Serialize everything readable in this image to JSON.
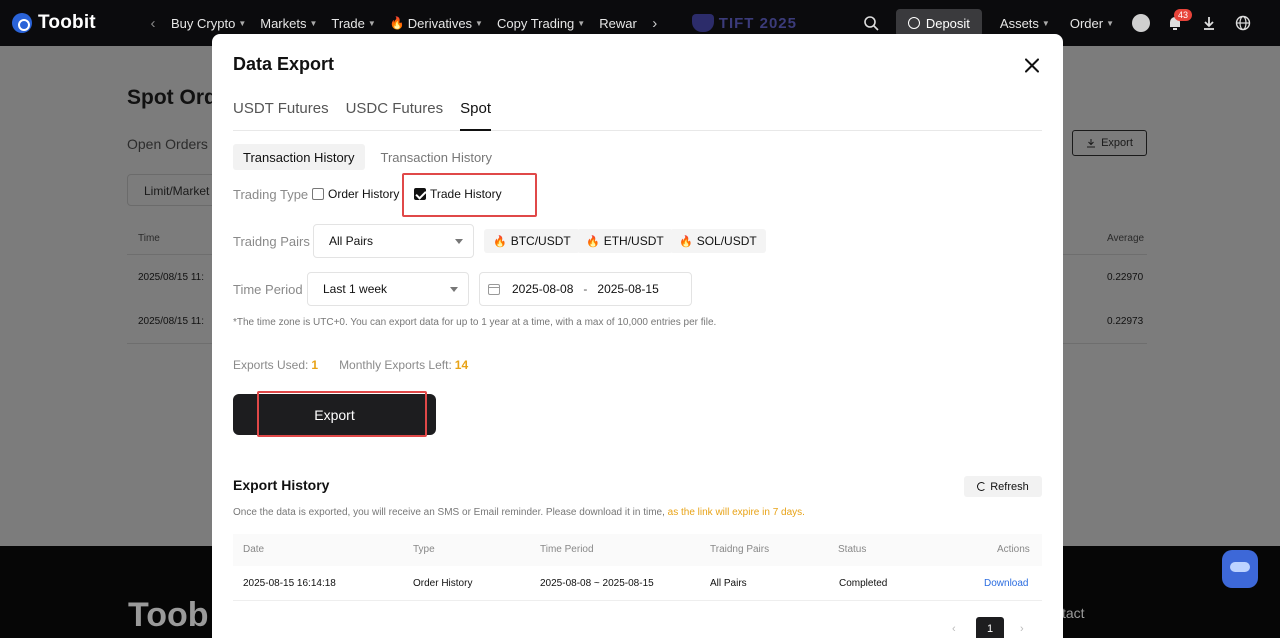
{
  "nav": {
    "brand": "Toobit",
    "items": [
      {
        "label": "Buy Crypto"
      },
      {
        "label": "Markets"
      },
      {
        "label": "Trade"
      },
      {
        "label": "Derivatives"
      },
      {
        "label": "Copy Trading"
      },
      {
        "label": "Rewar"
      }
    ],
    "event_label": "TIFT 2025",
    "deposit": "Deposit",
    "assets": "Assets",
    "order": "Order",
    "notification_count": "43"
  },
  "background": {
    "title": "Spot Ord",
    "tab": "Open Orders",
    "filter": "Limit/Market",
    "export": "Export",
    "col_time": "Time",
    "col_average": "Average",
    "rows": [
      {
        "time": "2025/08/15 11:",
        "average": "0.22970"
      },
      {
        "time": "2025/08/15 11:",
        "average": "0.22973"
      }
    ],
    "footer_logo": "Toob",
    "footer_contact": "tact"
  },
  "modal": {
    "title": "Data Export",
    "tabs": [
      {
        "label": "USDT Futures",
        "active": false
      },
      {
        "label": "USDC Futures",
        "active": false
      },
      {
        "label": "Spot",
        "active": true
      }
    ],
    "subtabs": [
      {
        "label": "Transaction History",
        "active": true
      },
      {
        "label": "Transaction History",
        "active": false
      }
    ],
    "trading_type_label": "Trading Type",
    "order_history_label": "Order History",
    "trade_history_label": "Trade History",
    "trading_pairs_label": "Traidng Pairs",
    "pairs_select": "All Pairs",
    "pair_chips": [
      "BTC/USDT",
      "ETH/USDT",
      "SOL/USDT"
    ],
    "time_period_label": "Time Period",
    "time_select": "Last 1 week",
    "date_start": "2025-08-08",
    "date_end": "2025-08-15",
    "range_separator": "-",
    "note": "*The time zone is UTC+0. You can export data for up to 1 year at a time, with a max of 10,000 entries per file.",
    "exports_used_label": "Exports Used:",
    "exports_used": "1",
    "monthly_left_label": "Monthly Exports Left:",
    "monthly_left": "14",
    "export_button": "Export",
    "history_title": "Export History",
    "refresh": "Refresh",
    "history_note": "Once the data is exported, you will receive an SMS or Email reminder. Please download it in time, ",
    "history_warning": "as the link will expire in 7 days.",
    "table": {
      "headers": [
        "Date",
        "Type",
        "Time Period",
        "Traidng Pairs",
        "Status",
        "Actions"
      ],
      "row": {
        "date": "2025-08-15 16:14:18",
        "type": "Order History",
        "period": "2025-08-08 ~ 2025-08-15",
        "pairs": "All Pairs",
        "status": "Completed",
        "action": "Download"
      }
    },
    "pager_page": "1"
  },
  "colors": {
    "accent_warn": "#e8a317",
    "link": "#2b6de0",
    "highlight_border": "#e04848"
  }
}
